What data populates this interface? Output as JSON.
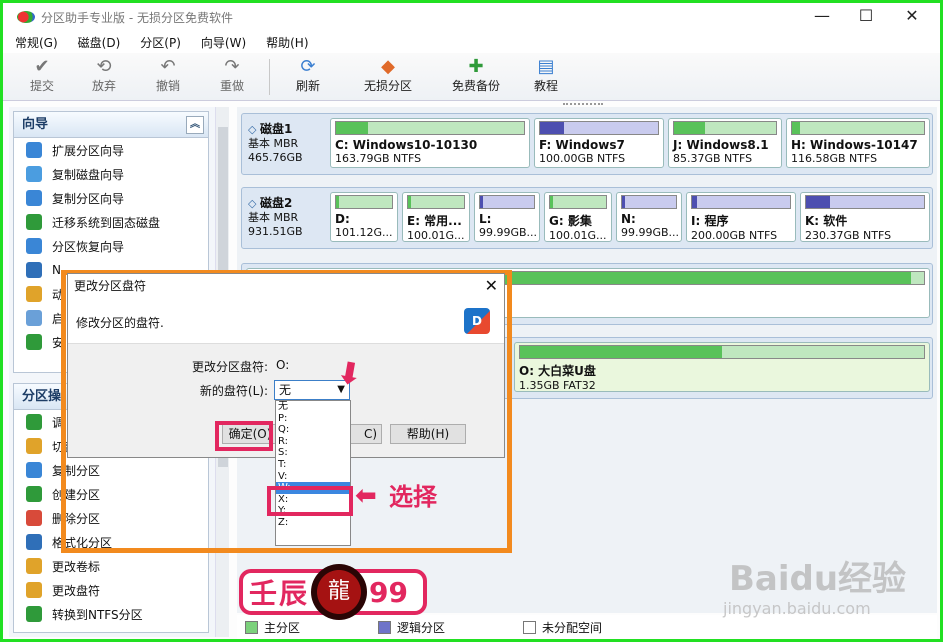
{
  "window": {
    "title": "分区助手专业版 - 无损分区免费软件",
    "minimize": "—",
    "maximize": "☐",
    "close": "✕"
  },
  "menu": [
    "常规(G)",
    "磁盘(D)",
    "分区(P)",
    "向导(W)",
    "帮助(H)"
  ],
  "toolbar": [
    {
      "label": "提交",
      "icon": "✔",
      "disabled": true
    },
    {
      "label": "放弃",
      "icon": "⟲",
      "disabled": true
    },
    {
      "label": "撤销",
      "icon": "↶",
      "disabled": true
    },
    {
      "label": "重做",
      "icon": "↷",
      "disabled": true
    },
    {
      "label": "刷新",
      "icon": "⟳",
      "disabled": false
    },
    {
      "label": "无损分区",
      "icon": "◆",
      "disabled": false
    },
    {
      "label": "免费备份",
      "icon": "✚",
      "disabled": false
    },
    {
      "label": "教程",
      "icon": "▤",
      "disabled": false
    }
  ],
  "sidebar": {
    "wizard": {
      "title": "向导",
      "collapse_icon": "︽",
      "items": [
        {
          "label": "扩展分区向导",
          "icon": "extend-partition-icon"
        },
        {
          "label": "复制磁盘向导",
          "icon": "copy-disk-icon"
        },
        {
          "label": "复制分区向导",
          "icon": "copy-partition-icon"
        },
        {
          "label": "迁移系统到固态磁盘",
          "icon": "migrate-os-icon"
        },
        {
          "label": "分区恢复向导",
          "icon": "partition-recovery-icon"
        },
        {
          "label": "N",
          "icon": "wizard-icon"
        },
        {
          "label": "动",
          "icon": "dynamic-disk-icon"
        },
        {
          "label": "启",
          "icon": "bootable-media-icon"
        },
        {
          "label": "安",
          "icon": "windows-to-go-icon"
        }
      ]
    },
    "ops": {
      "title": "分区操",
      "items": [
        {
          "label": "调",
          "icon": "resize-icon"
        },
        {
          "label": "切割分区",
          "icon": "split-icon"
        },
        {
          "label": "复制分区",
          "icon": "copy-icon"
        },
        {
          "label": "创建分区",
          "icon": "create-icon"
        },
        {
          "label": "删除分区",
          "icon": "delete-icon"
        },
        {
          "label": "格式化分区",
          "icon": "format-icon"
        },
        {
          "label": "更改卷标",
          "icon": "label-icon"
        },
        {
          "label": "更改盘符",
          "icon": "letter-icon"
        },
        {
          "label": "转换到NTFS分区",
          "icon": "convert-icon"
        }
      ]
    }
  },
  "disks": [
    {
      "name": "磁盘1",
      "type": "基本 MBR",
      "size": "465.76GB",
      "partitions": [
        {
          "name": "C: Windows10-10130",
          "info": "163.79GB NTFS",
          "kind": "primary",
          "used": 0.17
        },
        {
          "name": "F: Windows7",
          "info": "100.00GB NTFS",
          "kind": "logical",
          "used": 0.2
        },
        {
          "name": "J: Windows8.1",
          "info": "85.37GB NTFS",
          "kind": "primary",
          "used": 0.3
        },
        {
          "name": "H: Windows-10147",
          "info": "116.58GB NTFS",
          "kind": "primary",
          "used": 0.06
        }
      ]
    },
    {
      "name": "磁盘2",
      "type": "基本 MBR",
      "size": "931.51GB",
      "partitions": [
        {
          "name": "D:",
          "info": "101.12G...",
          "kind": "primary",
          "used": 0.05
        },
        {
          "name": "E: 常用...",
          "info": "100.01G...",
          "kind": "primary",
          "used": 0.05
        },
        {
          "name": "L:",
          "info": "99.99GB...",
          "kind": "logical",
          "used": 0.05
        },
        {
          "name": "G: 影集",
          "info": "100.01G...",
          "kind": "primary",
          "used": 0.05
        },
        {
          "name": "N:",
          "info": "99.99GB...",
          "kind": "logical",
          "used": 0.05
        },
        {
          "name": "I: 程序",
          "info": "200.00GB NTFS",
          "kind": "logical",
          "used": 0.05
        },
        {
          "name": "K: 软件",
          "info": "230.37GB NTFS",
          "kind": "logical",
          "used": 0.2
        }
      ]
    },
    {
      "name": "",
      "type": "",
      "size": "",
      "partitions": [
        {
          "name": "",
          "info": "",
          "kind": "primary",
          "used": 0.98
        }
      ]
    },
    {
      "name": "",
      "type": "",
      "size": "",
      "partitions": [
        {
          "name": "O: 大白菜U盘",
          "info": "1.35GB FAT32",
          "kind": "primary",
          "used": 0.5
        }
      ]
    }
  ],
  "legend": [
    {
      "label": "主分区",
      "color": "#7cd17c"
    },
    {
      "label": "逻辑分区",
      "color": "#6f74c9"
    },
    {
      "label": "未分配空间",
      "color": "#ffffff"
    }
  ],
  "dialog": {
    "title": "更改分区盘符",
    "close": "✕",
    "subtitle": "修改分区的盘符.",
    "logo": "D",
    "current_label": "更改分区盘符:",
    "current_value": "O:",
    "new_label": "新的盘符(L):",
    "selected": "无",
    "caret": "▼",
    "ok": "确定(O)",
    "cancel": "C)",
    "help": "帮助(H)",
    "options": [
      "无",
      "P:",
      "Q:",
      "R:",
      "S:",
      "T:",
      "V:",
      "W:",
      "X:",
      "Y:",
      "Z:"
    ],
    "highlighted_option": "W:"
  },
  "annotation": {
    "text": "选择",
    "arrow": "⬅",
    "arrow_down": "⬋"
  },
  "stamp": {
    "left": "壬辰",
    "emblem": "龍",
    "right": "99"
  },
  "watermark": {
    "main": "Baidu经验",
    "sub": "jingyan.baidu.com"
  },
  "colors": {
    "primary": "#59c25a",
    "logical": "#4d4fb0",
    "accent": "#e2275f"
  }
}
